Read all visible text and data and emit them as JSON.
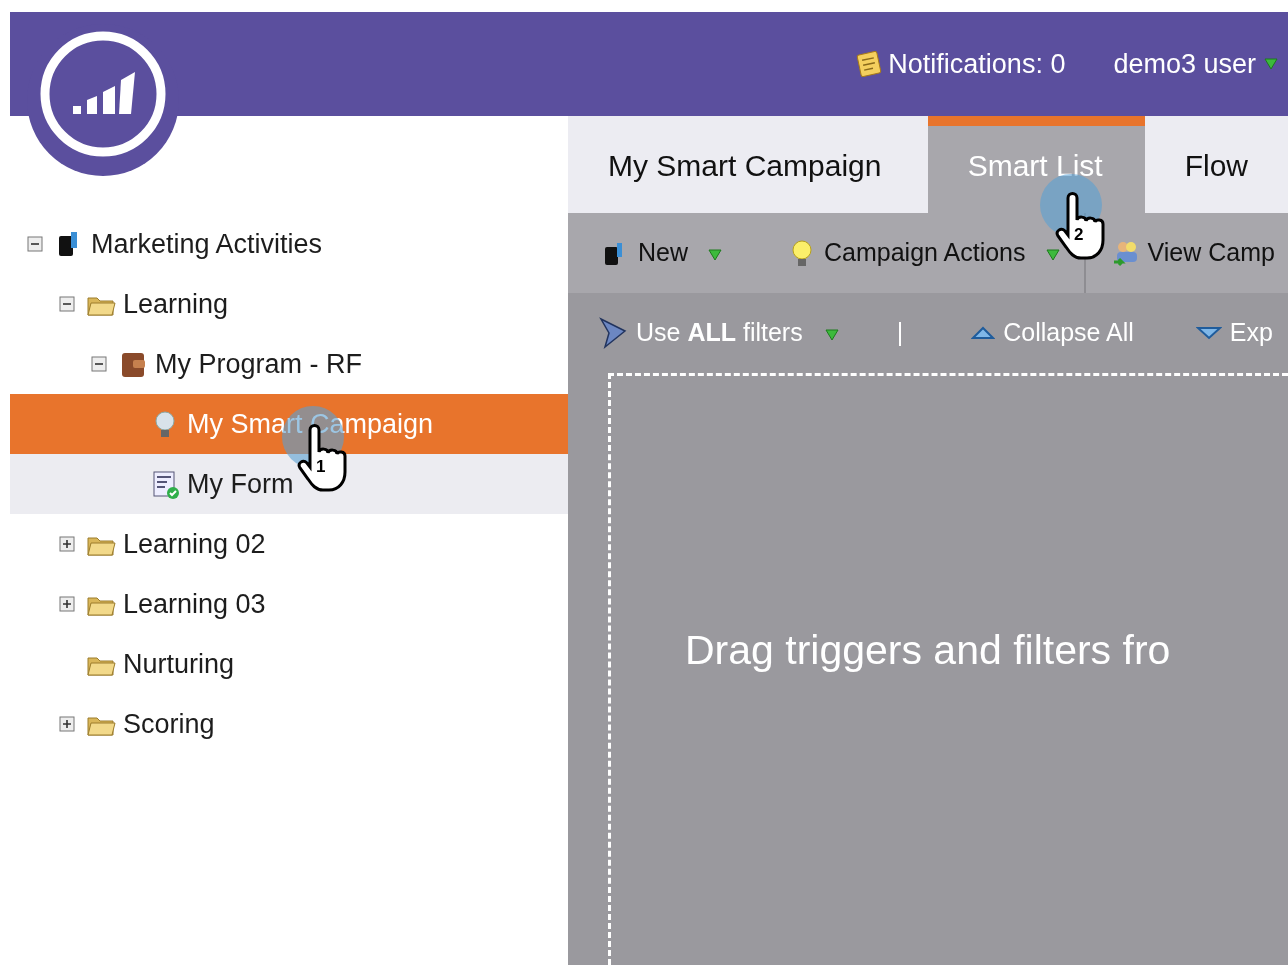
{
  "header": {
    "notifications": "Notifications: 0",
    "user": "demo3 user"
  },
  "tree": [
    {
      "label": "Marketing Activities",
      "kind": "root",
      "expanded": true,
      "selected": false,
      "highlighted": false,
      "children": [
        {
          "label": "Learning",
          "kind": "folder",
          "expanded": true,
          "selected": false,
          "highlighted": false,
          "children": [
            {
              "label": "My Program - RF",
              "kind": "program",
              "expanded": true,
              "selected": false,
              "highlighted": false,
              "children": [
                {
                  "label": "My Smart Campaign",
                  "kind": "campaign",
                  "selected": true,
                  "highlighted": false
                },
                {
                  "label": "My Form",
                  "kind": "form",
                  "selected": false,
                  "highlighted": true
                }
              ]
            }
          ]
        },
        {
          "label": "Learning 02",
          "kind": "folder",
          "expanded": false,
          "selected": false,
          "highlighted": false
        },
        {
          "label": "Learning 03",
          "kind": "folder",
          "expanded": false,
          "selected": false,
          "highlighted": false
        },
        {
          "label": "Nurturing",
          "kind": "folder",
          "selected": false,
          "highlighted": false
        },
        {
          "label": "Scoring",
          "kind": "folder",
          "expanded": false,
          "selected": false,
          "highlighted": false
        }
      ]
    }
  ],
  "tabs": [
    {
      "label": "My Smart Campaign",
      "selected": false
    },
    {
      "label": "Smart List",
      "selected": true
    },
    {
      "label": "Flow",
      "selected": false
    }
  ],
  "toolbar": [
    {
      "label": "New",
      "kind": "new",
      "dropdown": true
    },
    {
      "label": "Campaign Actions",
      "kind": "bulb",
      "dropdown": true
    },
    {
      "label": "View Camp",
      "kind": "people",
      "dropdown": false
    }
  ],
  "filter_bar": {
    "filter_mode": "Use **ALL** filters",
    "separator": "|",
    "collapse": "Collapse All",
    "expand": "Exp"
  },
  "canvas": {
    "message": "Drag triggers and filters fro"
  },
  "callouts": [
    {
      "label": "1"
    },
    {
      "label": "2"
    }
  ]
}
